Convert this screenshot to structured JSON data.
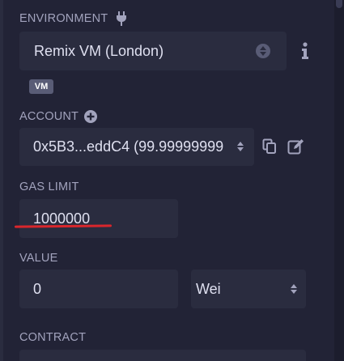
{
  "environment": {
    "label": "ENVIRONMENT",
    "plug_icon": "plug-icon",
    "selected": "Remix VM (London)",
    "info_icon": "info-icon",
    "badge": "VM"
  },
  "account": {
    "label": "ACCOUNT",
    "add_icon": "plus-circle-icon",
    "selected": "0x5B3...eddC4 (99.99999999",
    "copy_icon": "copy-icon",
    "edit_icon": "edit-icon"
  },
  "gas_limit": {
    "label": "GAS LIMIT",
    "value": "1000000"
  },
  "value": {
    "label": "VALUE",
    "amount": "0",
    "unit": "Wei"
  },
  "contract": {
    "label": "CONTRACT"
  },
  "colors": {
    "background": "#222336",
    "field": "#2a2c3f",
    "text": "#dfe0f0",
    "label": "#a2a3bd",
    "annotation_red": "#d9262c"
  }
}
